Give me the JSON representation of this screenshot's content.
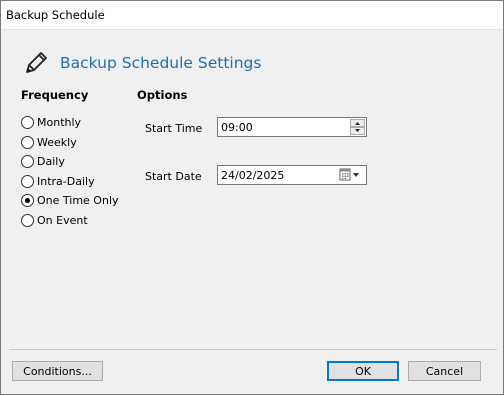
{
  "window": {
    "title": "Backup Schedule"
  },
  "header": {
    "title": "Backup Schedule Settings",
    "icon": "pencil-icon"
  },
  "frequency": {
    "label": "Frequency",
    "options": [
      {
        "label": "Monthly",
        "selected": false
      },
      {
        "label": "Weekly",
        "selected": false
      },
      {
        "label": "Daily",
        "selected": false
      },
      {
        "label": "Intra-Daily",
        "selected": false
      },
      {
        "label": "One Time Only",
        "selected": true
      },
      {
        "label": "On Event",
        "selected": false
      }
    ]
  },
  "options": {
    "label": "Options",
    "start_time": {
      "label": "Start Time",
      "value": "09:00"
    },
    "start_date": {
      "label": "Start Date",
      "value": "24/02/2025"
    }
  },
  "buttons": {
    "conditions": "Conditions...",
    "ok": "OK",
    "cancel": "Cancel"
  },
  "colors": {
    "heading": "#1f6fb2",
    "accent": "#0078d7"
  }
}
